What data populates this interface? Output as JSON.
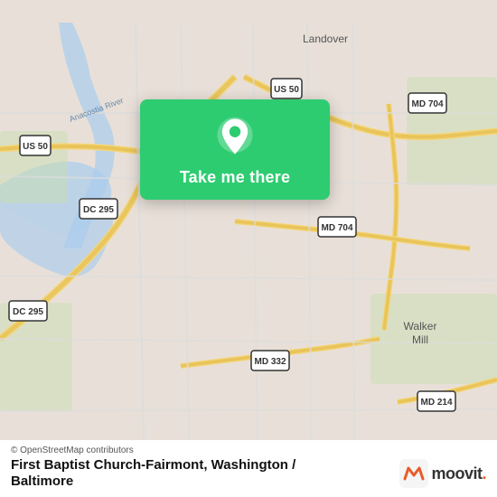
{
  "map": {
    "alt": "Map of Washington DC area near First Baptist Church-Fairmont",
    "background_color": "#e8e0d8"
  },
  "card": {
    "label": "Take me there",
    "pin_icon": "location-pin-icon"
  },
  "bottom_bar": {
    "attribution": "© OpenStreetMap contributors",
    "place_name": "First Baptist Church-Fairmont, Washington /",
    "place_name_line2": "Baltimore",
    "moovit_label": "moovit"
  }
}
